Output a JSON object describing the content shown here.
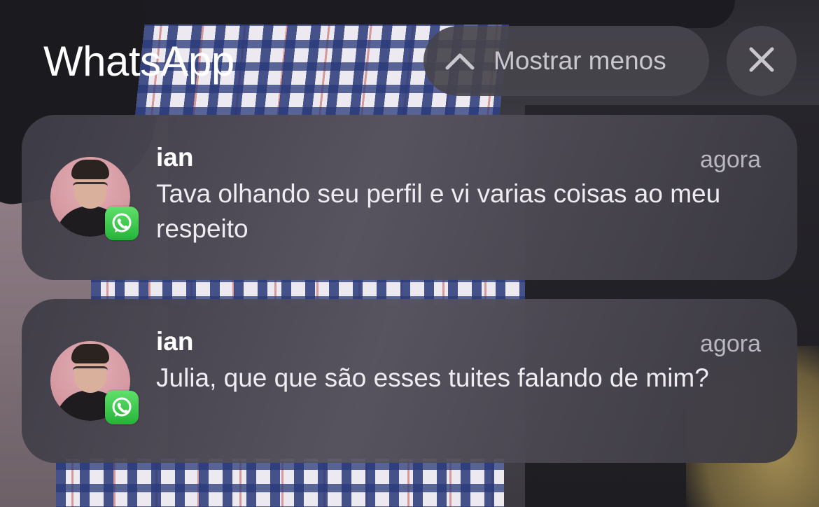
{
  "header": {
    "app_name": "WhatsApp",
    "show_less_label": "Mostrar menos",
    "show_less_icon": "chevron-up-icon",
    "close_icon": "close-icon"
  },
  "notifications": [
    {
      "sender": "ian",
      "time": "agora",
      "message": "Tava olhando seu perfil e vi varias coisas ao meu respeito",
      "badge_icon": "whatsapp-icon"
    },
    {
      "sender": "ian",
      "time": "agora",
      "message": "Julia, que que são esses tuites falando de mim?",
      "badge_icon": "whatsapp-icon"
    }
  ],
  "colors": {
    "whatsapp_green": "#25D366",
    "pill_background": "#46444C",
    "text_primary": "#FFFFFF",
    "text_secondary": "#B9B6BF"
  }
}
